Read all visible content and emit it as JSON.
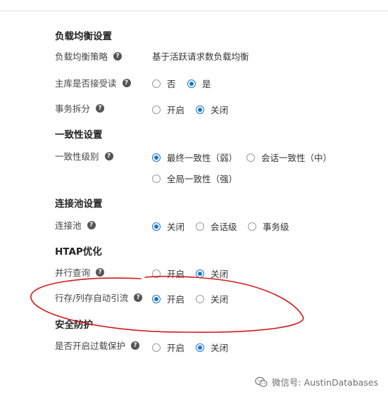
{
  "load_balance": {
    "title": "负载均衡设置",
    "strategy_label": "负载均衡策略",
    "strategy_value": "基于活跃请求数负载均衡",
    "primary_read_label": "主库是否接受读",
    "primary_read_no": "否",
    "primary_read_yes": "是",
    "txn_split_label": "事务拆分",
    "txn_split_on": "开启",
    "txn_split_off": "关闭"
  },
  "consistency": {
    "title": "一致性设置",
    "level_label": "一致性级别",
    "opt_eventual": "最终一致性（弱）",
    "opt_session": "会话一致性（中）",
    "opt_global": "全局一致性（强）"
  },
  "pool": {
    "title": "连接池设置",
    "label": "连接池",
    "opt_off": "关闭",
    "opt_session": "会话级",
    "opt_txn": "事务级"
  },
  "htap": {
    "title": "HTAP优化",
    "parallel_label": "并行查询",
    "parallel_on": "开启",
    "parallel_off": "关闭",
    "rowcol_label": "行存/列存自动引流",
    "rowcol_on": "开启",
    "rowcol_off": "关闭"
  },
  "security": {
    "title": "安全防护",
    "overload_label": "是否开启过载保护",
    "overload_on": "开启",
    "overload_off": "关闭"
  },
  "help_glyph": "?",
  "watermark": {
    "text": "微信号: AustinDatabases"
  },
  "colors": {
    "accent": "#1a73c9",
    "annotation": "#d0191c"
  },
  "icons": {
    "help": "question-circle-icon",
    "watermark": "wechat-icon"
  }
}
